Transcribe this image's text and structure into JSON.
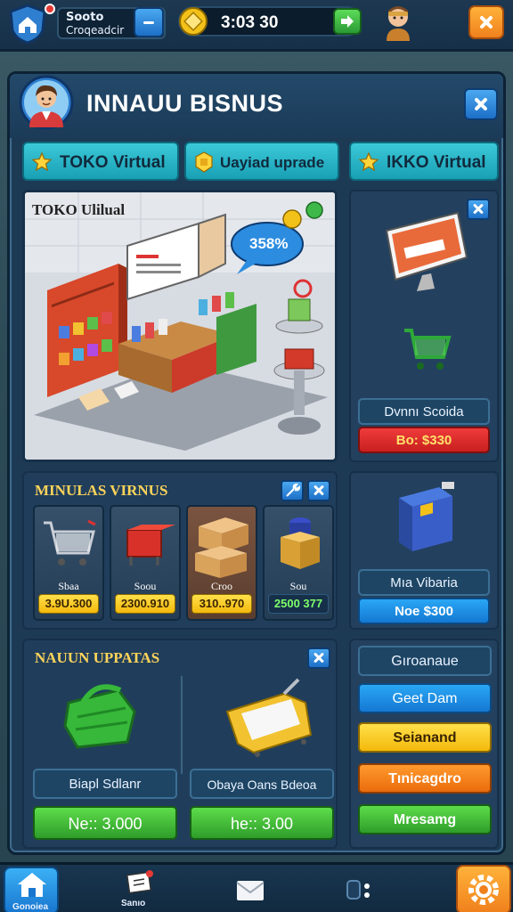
{
  "topbar": {
    "store_line1": "Sooto",
    "store_line2": "Croqeadcir",
    "money": "3:03 30"
  },
  "panel": {
    "title": "INNAUU BISNUS"
  },
  "tabs": [
    {
      "label": "TOKO Virtual"
    },
    {
      "label": "Uayiad uprade"
    },
    {
      "label": "IKKO Virtual"
    }
  ],
  "store": {
    "name": "TOKO Ulilual",
    "bubble": "358%"
  },
  "right_cards": {
    "card1": {
      "label": "Dvnnı Scoida",
      "price": "Bo: $330"
    },
    "card2": {
      "label": "Mıa Vibaria",
      "price": "Noe $300"
    },
    "card3": {
      "buttons": [
        "Gıroanaue",
        "Geet Dam",
        "Seianand",
        "Tınicagdro",
        "Mresamg"
      ]
    }
  },
  "minulas": {
    "title": "MINULAS VIRNUS",
    "items": [
      {
        "name": "Sbaa",
        "price": "3.9U.300"
      },
      {
        "name": "Soou",
        "price": "2300.910"
      },
      {
        "name": "Croo",
        "price": "310..970"
      },
      {
        "name": "Sou",
        "price": "2500 377"
      }
    ]
  },
  "upgrades": {
    "title": "NAUUN UPPATAS",
    "left": {
      "label": "Biapl Sdlanr",
      "price": "Ne:: 3.000"
    },
    "right": {
      "label": "Obaya Oans Bdeoa",
      "price": "he:: 3.00"
    }
  },
  "bottom_nav": {
    "home_label": "Gonoiea",
    "store_label": "Sanıo"
  },
  "colors": {
    "accent_blue": "#1d6fc7",
    "tab_teal": "#3bc9d9",
    "title_gold": "#ffd45a",
    "price_red": "#c81f1f",
    "green_button": "#2e9d2a",
    "orange_button": "#ea6c0c"
  }
}
